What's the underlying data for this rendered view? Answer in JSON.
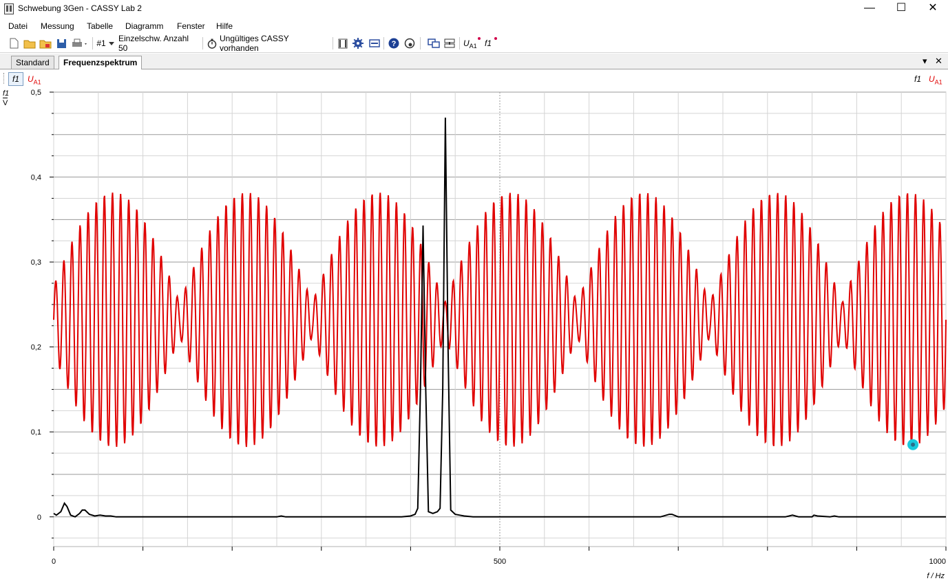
{
  "window": {
    "title": "Schwebung 3Gen - CASSY Lab 2",
    "controls": {
      "minimize": "—",
      "maximize": "☐",
      "close": "✕"
    }
  },
  "menu": [
    "Datei",
    "Messung",
    "Tabelle",
    "Diagramm",
    "Fenster",
    "Hilfe"
  ],
  "toolbar": {
    "measurement": "#1",
    "mode": "Einzelschw. Anzahl 50",
    "status": "Ungültiges CASSY vorhanden",
    "quantity_u": "U",
    "quantity_u_sub": "A1",
    "quantity_f": "f1"
  },
  "tabs": {
    "standard": "Standard",
    "active": "Frequenzspektrum",
    "dropdown": "▾",
    "close": "✕"
  },
  "subbar": {
    "f1": "f1",
    "u": "U",
    "u_sub": "A1"
  },
  "yaxis_label": {
    "num": "f1",
    "den": "V"
  },
  "colors": {
    "spectrum": "#000000",
    "signal": "#e00000",
    "cursor": "#19c9dc"
  },
  "chart_data": {
    "type": "line",
    "xlabel": "f / Hz",
    "xlim": [
      0,
      1000
    ],
    "ylim": [
      -0.035,
      0.5
    ],
    "x_tick_labels": [
      0,
      500,
      1000
    ],
    "x_tick_step": 100,
    "y_tick_labels": [
      "0,5",
      "0,4",
      "0,3",
      "0,2",
      "0,1",
      "0"
    ],
    "y_tick_values": [
      0.5,
      0.4,
      0.3,
      0.2,
      0.1,
      0
    ],
    "grid": true,
    "series": [
      {
        "name": "f1",
        "color": "#000000",
        "points": [
          [
            0,
            0.004
          ],
          [
            3,
            0.002
          ],
          [
            8,
            0.006
          ],
          [
            12,
            0.016
          ],
          [
            15,
            0.012
          ],
          [
            19,
            0.002
          ],
          [
            24,
            0.0
          ],
          [
            29,
            0.004
          ],
          [
            32,
            0.008
          ],
          [
            35,
            0.008
          ],
          [
            40,
            0.003
          ],
          [
            46,
            0.001
          ],
          [
            52,
            0.002
          ],
          [
            58,
            0.001
          ],
          [
            64,
            0.001
          ],
          [
            70,
            0.0
          ],
          [
            100,
            0.0
          ],
          [
            200,
            0.0
          ],
          [
            250,
            0.0
          ],
          [
            255,
            0.001
          ],
          [
            260,
            0.0
          ],
          [
            300,
            0.0
          ],
          [
            320,
            0.0
          ],
          [
            350,
            0.0
          ],
          [
            390,
            0.0
          ],
          [
            400,
            0.001
          ],
          [
            405,
            0.003
          ],
          [
            408,
            0.01
          ],
          [
            411,
            0.15
          ],
          [
            414,
            0.343
          ],
          [
            417,
            0.15
          ],
          [
            420,
            0.006
          ],
          [
            425,
            0.004
          ],
          [
            430,
            0.006
          ],
          [
            433,
            0.01
          ],
          [
            436,
            0.15
          ],
          [
            439,
            0.47
          ],
          [
            442,
            0.2
          ],
          [
            445,
            0.008
          ],
          [
            450,
            0.003
          ],
          [
            455,
            0.002
          ],
          [
            460,
            0.001
          ],
          [
            470,
            0.0
          ],
          [
            500,
            0.0
          ],
          [
            550,
            0.0
          ],
          [
            600,
            0.0
          ],
          [
            680,
            0.0
          ],
          [
            690,
            0.003
          ],
          [
            693,
            0.003
          ],
          [
            700,
            0.0
          ],
          [
            750,
            0.0
          ],
          [
            820,
            0.0
          ],
          [
            828,
            0.002
          ],
          [
            835,
            0.0
          ],
          [
            850,
            0.0
          ],
          [
            852,
            0.002
          ],
          [
            856,
            0.001
          ],
          [
            870,
            0.0
          ],
          [
            875,
            0.001
          ],
          [
            880,
            0.0
          ],
          [
            950,
            0.0
          ],
          [
            1000,
            0.0
          ]
        ]
      },
      {
        "name": "U A1",
        "color": "#e00000",
        "generator": {
          "center": 0.232,
          "amp_max": 0.15,
          "amp_min": 0.02,
          "carrier_cycles": 110,
          "beat_period_hz": 148.5,
          "beat_phase_hz": 67
        }
      }
    ],
    "cursor": {
      "x": 963,
      "y": 0.085
    }
  }
}
